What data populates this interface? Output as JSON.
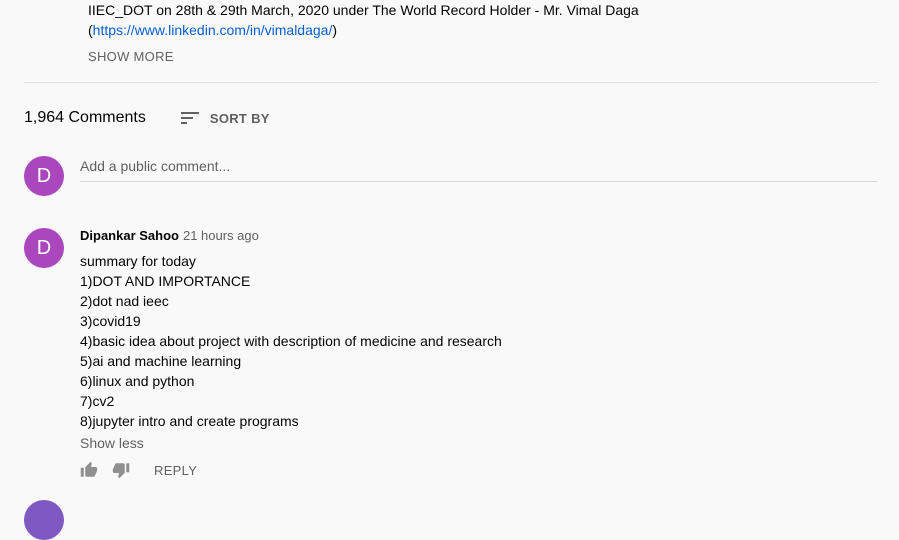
{
  "description": {
    "line1": "IIEC_DOT on 28th & 29th March, 2020 under The World Record Holder - Mr. Vimal Daga",
    "link_open": "(",
    "link_text": "https://www.linkedin.com/in/vimaldaga/",
    "link_close": ")",
    "show_more_label": "SHOW MORE"
  },
  "comments_header": {
    "count_text": "1,964 Comments",
    "sort_label": "SORT BY",
    "sort_icon": "sort-icon"
  },
  "add_comment": {
    "avatar_letter": "D",
    "avatar_color": "#ab47bc",
    "placeholder": "Add a public comment..."
  },
  "comments": [
    {
      "avatar_letter": "D",
      "avatar_color": "#ab47bc",
      "author": "Dipankar Sahoo",
      "time": "21 hours ago",
      "lines": [
        "summary for today",
        "1)DOT AND IMPORTANCE",
        "2)dot nad ieec",
        "3)covid19",
        "4)basic idea about project with description of medicine and research",
        "5)ai and machine learning",
        "6)linux and python",
        "7)cv2",
        "8)jupyter intro and create programs"
      ],
      "show_less_label": "Show less",
      "reply_label": "REPLY",
      "like_icon": "thumbs-up-icon",
      "dislike_icon": "thumbs-down-icon"
    }
  ],
  "colors": {
    "link": "#065fd4",
    "secondary_text": "#606060",
    "background": "#f9f9f9"
  }
}
